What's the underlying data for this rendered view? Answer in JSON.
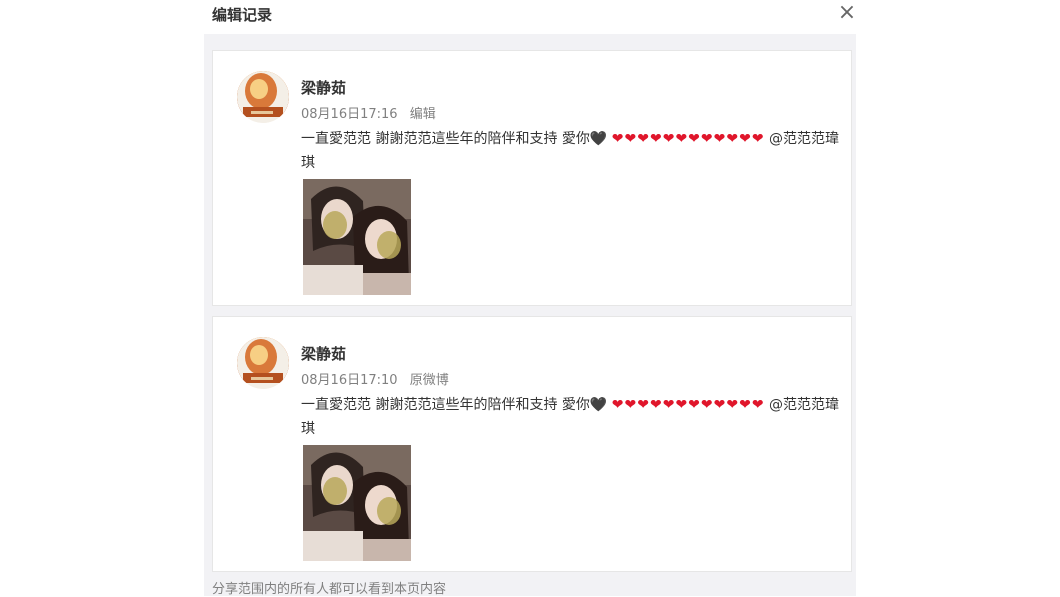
{
  "dialog": {
    "title": "编辑记录",
    "close_icon": "close-icon"
  },
  "records": [
    {
      "author": "梁静茹",
      "time": "08月16日17:16",
      "tag": "编辑",
      "text_main": "一直愛范范 謝謝范范這些年的陪伴和支持 愛你🖤",
      "hearts": "❤❤❤❤❤❤❤❤❤❤❤❤",
      "mention": "@范范范瑋琪"
    },
    {
      "author": "梁静茹",
      "time": "08月16日17:10",
      "tag": "原微博",
      "text_main": "一直愛范范 謝謝范范這些年的陪伴和支持 愛你🖤",
      "hearts": "❤❤❤❤❤❤❤❤❤❤❤❤",
      "mention": "@范范范瑋琪"
    }
  ],
  "footer": {
    "note": "分享范围内的所有人都可以看到本页内容"
  },
  "colors": {
    "panel_bg": "#f2f2f5",
    "heart": "#e0162b",
    "meta_text": "#808080"
  }
}
